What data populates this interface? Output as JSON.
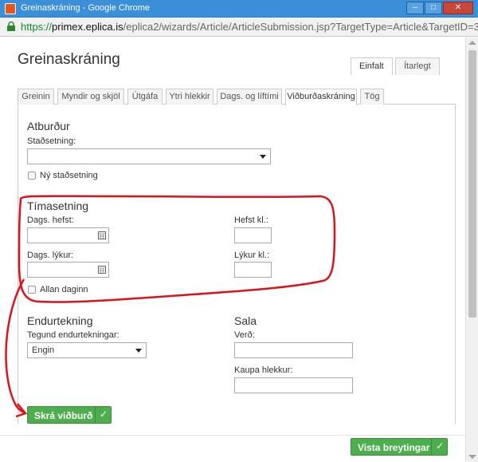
{
  "window": {
    "title": "Greinaskráning - Google Chrome",
    "min_glyph": "–",
    "max_glyph": "□",
    "close_glyph": "✕"
  },
  "address": {
    "scheme": "https://",
    "host": "primex.eplica.is",
    "path": "/eplica2/wizards/Article/ArticleSubmission.jsp?TargetType=Article&TargetID=39"
  },
  "dialog": {
    "title": "Greinaskráning",
    "mode_tabs": [
      "Einfalt",
      "Ítarlegt"
    ]
  },
  "tabs": [
    "Greinin",
    "Myndir og skjöl",
    "Útgáfa",
    "Ytri hlekkir",
    "Dags. og líftími",
    "Viðburðaskráning",
    "Tög"
  ],
  "active_tab": "Viðburðaskráning",
  "event": {
    "title": "Atburður",
    "location_label": "Staðsetning:",
    "location_value": "",
    "new_location_label": "Ný staðsetning"
  },
  "timing": {
    "title": "Tímasetning",
    "start_date_label": "Dags. hefst:",
    "start_time_label": "Hefst kl.:",
    "end_date_label": "Dags. lýkur:",
    "end_time_label": "Lýkur kl.:",
    "all_day_label": "Allan daginn"
  },
  "recurrence": {
    "title": "Endurtekning",
    "type_label": "Tegund endurtekningar:",
    "type_value": "Engin"
  },
  "sales": {
    "title": "Sala",
    "price_label": "Verð:",
    "buy_link_label": "Kaupa hlekkur:"
  },
  "buttons": {
    "register_event": "Skrá viðburð",
    "save_changes": "Vista breytingar",
    "check_glyph": "✓"
  },
  "colors": {
    "annotation_red": "#d9141c",
    "button_green": "#4cae4c",
    "titlebar_blue": "#3a8fd8"
  }
}
